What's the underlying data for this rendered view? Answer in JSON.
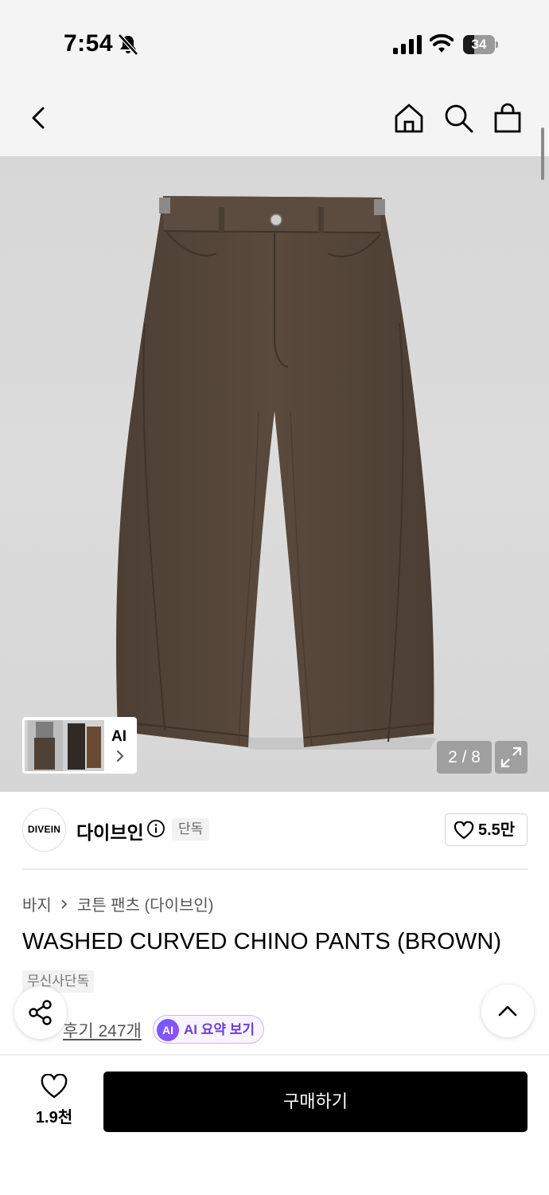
{
  "status_bar": {
    "time": "7:54",
    "battery": "34",
    "battery_level": 0.34
  },
  "nav": {
    "back_icon": "chevron-left-icon",
    "home_icon": "home-icon",
    "search_icon": "search-icon",
    "cart_icon": "shopping-bag-icon"
  },
  "gallery": {
    "counter": "2 / 8",
    "thumbnail_label": "AI",
    "expand_icon": "expand-icon"
  },
  "brand": {
    "logo_text": "DIVEIN",
    "name": "다이브인",
    "exclusive_badge": "단독",
    "like_count": "5.5만"
  },
  "product": {
    "breadcrumb": [
      "바지",
      "코튼 팬츠 (다이브인)"
    ],
    "title": "WASHED CURVED CHINO PANTS (BROWN)",
    "store_badge": "무신사단독",
    "review_link": "후기 247개",
    "ai_badge": "AI",
    "ai_summary": "AI 요약 보기"
  },
  "bottom_bar": {
    "like_count": "1.9천",
    "buy_label": "구매하기"
  },
  "colors": {
    "pants": "#55463a",
    "buy_button": "#000000",
    "ai_accent": "#6a3fd6"
  }
}
